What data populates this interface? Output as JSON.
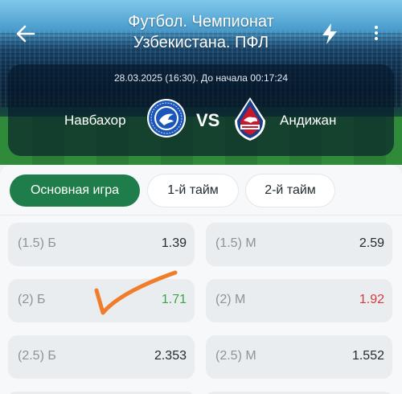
{
  "header": {
    "title": "Футбол. Чемпионат Узбекистана. ПФЛ",
    "match_time": "28.03.2025 (16:30). До начала 00:17:24",
    "team_home": "Навбахор",
    "team_away": "Андижан",
    "vs_label": "VS",
    "team_home_logo_text": "F.C. NAVBAHOR NAMANGAN",
    "team_away_logo_text": "ANDIJON"
  },
  "tabs": [
    {
      "label": "Основная игра",
      "active": true
    },
    {
      "label": "1-й тайм",
      "active": false
    },
    {
      "label": "2-й тайм",
      "active": false
    }
  ],
  "odds": [
    {
      "left": {
        "label": "(1.5) Б",
        "value": "1.39"
      },
      "right": {
        "label": "(1.5) М",
        "value": "2.59"
      }
    },
    {
      "left": {
        "label": "(2) Б",
        "value": "1.71",
        "trend": "up"
      },
      "right": {
        "label": "(2) М",
        "value": "1.92",
        "trend": "down"
      }
    },
    {
      "left": {
        "label": "(2.5) Б",
        "value": "2.353"
      },
      "right": {
        "label": "(2.5) М",
        "value": "1.552"
      }
    }
  ],
  "colors": {
    "accent": "#1e7d4a",
    "odds_up": "#3aa545",
    "odds_down": "#d63a3a",
    "annotation": "#f07d2a"
  },
  "icons": {
    "back": "arrow-left-icon",
    "bolt": "lightning-icon",
    "more": "more-vertical-icon",
    "annotation": "checkmark-annotation"
  }
}
